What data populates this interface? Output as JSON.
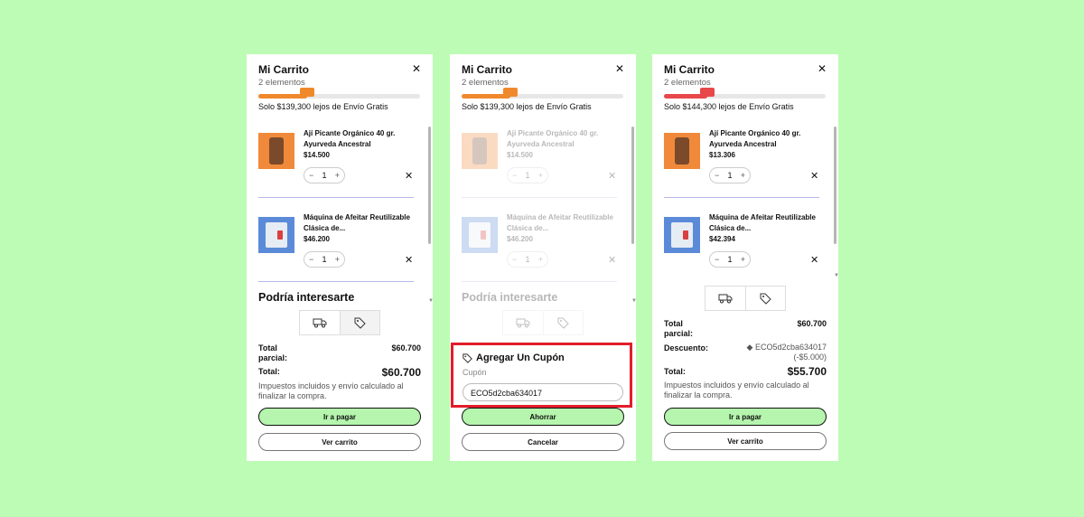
{
  "colors": {
    "background": "#bdfcb4",
    "accent": "#b5f5ad",
    "progress_orange": "#f0892c",
    "progress_red": "#e8484a",
    "highlight": "#e21d2b"
  },
  "panels": [
    {
      "title": "Mi Carrito",
      "count": "2 elementos",
      "shipping": "Solo $139,300 lejos de Envío Gratis",
      "progress": 0.3,
      "items": [
        {
          "name": "Ají Picante Orgánico 40 gr. Ayurveda Ancestral",
          "price": "$14.500",
          "qty": "1",
          "icon": "jar-image"
        },
        {
          "name": "Máquina de Afeitar Reutilizable Clásica de...",
          "price": "$46.200",
          "qty": "1",
          "icon": "razor-image"
        }
      ],
      "interest": "Podría interesarte",
      "subtotal_label": "Total parcial:",
      "subtotal": "$60.700",
      "total_label": "Total:",
      "total": "$60.700",
      "note": "Impuestos incluidos y envío calculado al finalizar la compra.",
      "primary_btn": "Ir a pagar",
      "secondary_btn": "Ver carrito"
    },
    {
      "title": "Mi Carrito",
      "count": "2 elementos",
      "shipping": "Solo $139,300 lejos de Envío Gratis",
      "progress": 0.3,
      "items": [
        {
          "name": "Ají Picante Orgánico 40 gr. Ayurveda Ancestral",
          "price": "$14.500",
          "qty": "1",
          "icon": "jar-image"
        },
        {
          "name": "Máquina de Afeitar Reutilizable Clásica de...",
          "price": "$46.200",
          "qty": "1",
          "icon": "razor-image"
        }
      ],
      "interest": "Podría interesarte",
      "coupon": {
        "title": "Agregar Un Cupón",
        "subtitle": "Cupón",
        "value": "ECO5d2cba634017",
        "placeholder": "Cupón"
      },
      "primary_btn": "Ahorrar",
      "secondary_btn": "Cancelar"
    },
    {
      "title": "Mi Carrito",
      "count": "2 elementos",
      "shipping": "Solo $144,300 lejos de Envío Gratis",
      "progress": 0.27,
      "items": [
        {
          "name": "Ají Picante Orgánico 40 gr. Ayurveda Ancestral",
          "price": "$13.306",
          "qty": "1",
          "icon": "jar-image"
        },
        {
          "name": "Máquina de Afeitar Reutilizable Clásica de...",
          "price": "$42.394",
          "qty": "1",
          "icon": "razor-image"
        }
      ],
      "subtotal_label": "Total parcial:",
      "subtotal": "$60.700",
      "discount_label": "Descuento:",
      "discount_code": "ECO5d2cba634017",
      "discount_amount": "(-$5.000)",
      "total_label": "Total:",
      "total": "$55.700",
      "note": "Impuestos incluidos y envío calculado al finalizar la compra.",
      "primary_btn": "Ir a pagar",
      "secondary_btn": "Ver carrito"
    }
  ],
  "icons": {
    "close": "close-icon",
    "truck": "truck-icon",
    "tag": "tag-icon",
    "minus": "minus-icon",
    "plus": "plus-icon",
    "remove": "remove-icon"
  },
  "glyphs": {
    "close": "✕",
    "minus": "−",
    "plus": "+",
    "remove": "✕"
  }
}
